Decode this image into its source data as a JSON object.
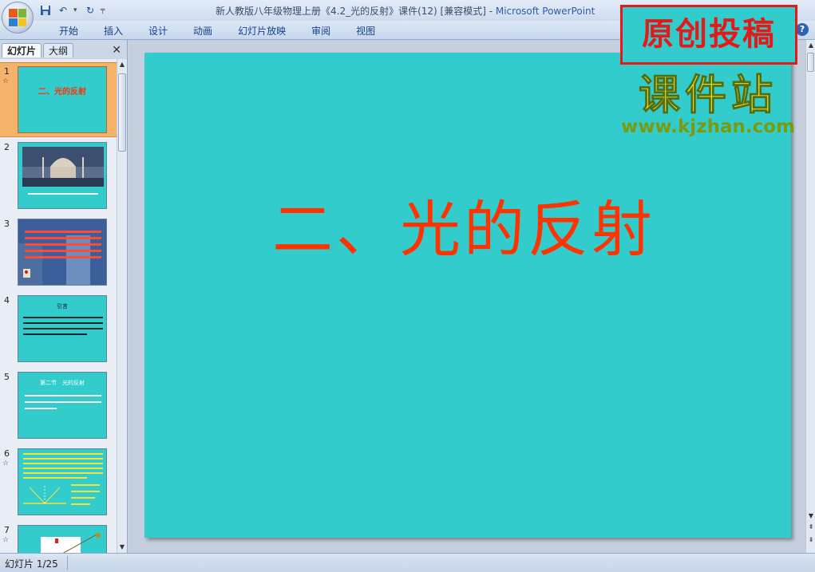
{
  "window": {
    "title": "新人教版八年级物理上册《4.2_光的反射》课件(12) [兼容模式] - ",
    "app_name": "Microsoft PowerPoint"
  },
  "quick_access": {
    "icons": [
      "save-icon",
      "undo-icon",
      "redo-icon",
      "customize-icon"
    ],
    "undo_glyph": "↶",
    "redo_glyph": "↻",
    "dropdown_glyph": "▾",
    "customize_glyph": "╤"
  },
  "ribbon": {
    "tabs": [
      "开始",
      "插入",
      "设计",
      "动画",
      "幻灯片放映",
      "审阅",
      "视图"
    ],
    "help_label": "?"
  },
  "left_pane": {
    "tab_slides": "幻灯片",
    "tab_outline": "大纲",
    "close_glyph": "✕",
    "slides": [
      {
        "num": "1",
        "star": "☆",
        "title": "二、光的反射",
        "selected": true
      },
      {
        "num": "2",
        "star": "",
        "title": "",
        "selected": false
      },
      {
        "num": "3",
        "star": "",
        "title": "",
        "selected": false
      },
      {
        "num": "4",
        "star": "",
        "title": "引言",
        "selected": false
      },
      {
        "num": "5",
        "star": "",
        "title": "第二节　光的反射",
        "selected": false
      },
      {
        "num": "6",
        "star": "☆",
        "title": "",
        "selected": false
      },
      {
        "num": "7",
        "star": "☆",
        "title": "",
        "selected": false
      }
    ]
  },
  "slide": {
    "title": "二、光的反射",
    "background": "#33cccc",
    "title_color": "#ff3300"
  },
  "watermark": {
    "stamp": "原创投稿",
    "site_name": "课件站",
    "url": "www.kjzhan.com"
  },
  "status": {
    "slide_counter": "幻灯片 1/25"
  },
  "colors": {
    "accent": "#2d5fa8",
    "selected_thumb": "#f4b26b",
    "stamp_red": "#e41a1a"
  }
}
